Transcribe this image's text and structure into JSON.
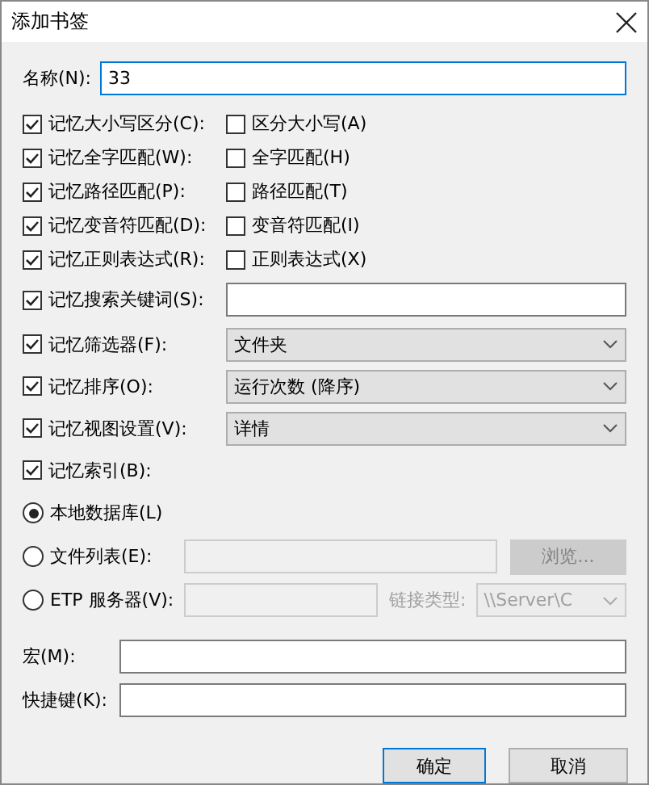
{
  "window": {
    "title": "添加书签"
  },
  "name": {
    "label": "名称(N):",
    "value": "33"
  },
  "option_pairs": [
    {
      "memory": {
        "label": "记忆大小写区分(C):",
        "checked": true
      },
      "option": {
        "label": "区分大小写(A)",
        "checked": false
      }
    },
    {
      "memory": {
        "label": "记忆全字匹配(W):",
        "checked": true
      },
      "option": {
        "label": "全字匹配(H)",
        "checked": false
      }
    },
    {
      "memory": {
        "label": "记忆路径匹配(P):",
        "checked": true
      },
      "option": {
        "label": "路径匹配(T)",
        "checked": false
      }
    },
    {
      "memory": {
        "label": "记忆变音符匹配(D):",
        "checked": true
      },
      "option": {
        "label": "变音符匹配(I)",
        "checked": false
      }
    },
    {
      "memory": {
        "label": "记忆正则表达式(R):",
        "checked": true
      },
      "option": {
        "label": "正则表达式(X)",
        "checked": false
      }
    }
  ],
  "memory_rows": [
    {
      "kind": "text",
      "label": "记忆搜索关键词(S):",
      "checked": true
    },
    {
      "kind": "select",
      "label": "记忆筛选器(F):",
      "checked": true,
      "value": "文件夹"
    },
    {
      "kind": "select",
      "label": "记忆排序(O):",
      "checked": true,
      "value": "运行次数 (降序)"
    },
    {
      "kind": "select",
      "label": "记忆视图设置(V):",
      "checked": true,
      "value": "详情"
    },
    {
      "kind": "none",
      "label": "记忆索引(B):",
      "checked": true
    }
  ],
  "sources": [
    {
      "kind": "plain",
      "label": "本地数据库(L)",
      "selected": true
    },
    {
      "kind": "file",
      "label": "文件列表(E):",
      "selected": false,
      "disabled": true,
      "button": "浏览..."
    },
    {
      "kind": "server",
      "label": "ETP 服务器(V):",
      "selected": false,
      "disabled": true,
      "link_label": "链接类型:",
      "link_value": "\\\\Server\\C"
    }
  ],
  "fields": [
    {
      "label": "宏(M):"
    },
    {
      "label": "快捷键(K):"
    }
  ],
  "buttons": [
    {
      "label": "确定",
      "default": true
    },
    {
      "label": "取消",
      "default": false
    }
  ]
}
